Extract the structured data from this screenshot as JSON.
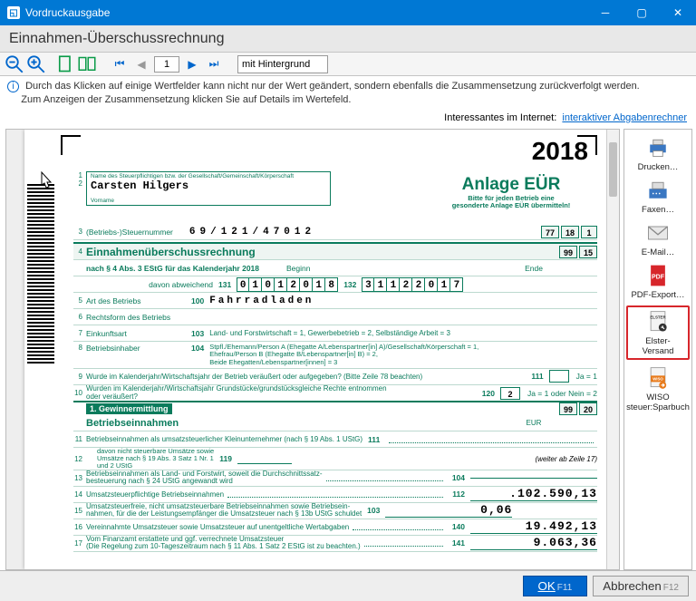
{
  "window": {
    "title": "Vordruckausgabe"
  },
  "header": {
    "title": "Einnahmen-Überschussrechnung"
  },
  "toolbar": {
    "page_current": "1",
    "bg_option": "mit Hintergrund"
  },
  "hint": {
    "line1": "Durch das Klicken auf einige Wertfelder kann nicht nur der Wert geändert, sondern ebenfalls die Zusammensetzung zurückverfolgt werden.",
    "line2": "Zum Anzeigen der Zusammensetzung klicken Sie auf Details im Wertefeld."
  },
  "interest_label": "Interessantes im Internet:",
  "interest_link": "interaktiver Abgabenrechner",
  "form": {
    "year": "2018",
    "name_label": "Name des Steuerpflichtigen bzw. der Gesellschaft/Gemeinschaft/Körperschaft",
    "name_value": "Carsten Hilgers",
    "vorname_label": "Vorname",
    "anlage_title": "Anlage EÜR",
    "anlage_sub": "Bitte für jeden Betrieb eine\ngesonderte Anlage EÜR übermitteln!",
    "steuernummer_label": "(Betriebs-)Steuernummer",
    "steuernummer_value": "69/121/47012",
    "top_cells": [
      "77",
      "18",
      "1"
    ],
    "header2": "Einnahmenüberschussrechnung",
    "header2_cells": [
      "99",
      "15"
    ],
    "subline": "nach § 4 Abs. 3 EStG für das Kalenderjahr 2018",
    "beginn_label": "Beginn",
    "ende_label": "Ende",
    "abweichend": "davon abweichend",
    "code_131": "131",
    "code_132": "132",
    "beginn_date": [
      "0",
      "1",
      "0",
      "1",
      "2",
      "0",
      "1",
      "8"
    ],
    "ende_date": [
      "3",
      "1",
      "1",
      "2",
      "2",
      "0",
      "1",
      "7"
    ],
    "r5_label": "Art des Betriebs",
    "r5_code": "100",
    "r5_value": "Fahrradladen",
    "r6_label": "Rechtsform des Betriebs",
    "r7_label": "Einkunftsart",
    "r7_code": "103",
    "r7_text": "Land- und Forstwirtschaft = 1, Gewerbebetrieb = 2, Selbständige Arbeit = 3",
    "r8_label": "Betriebsinhaber",
    "r8_code": "104",
    "r8_text": "Stpfl./Ehemann/Person A (Ehegatte A/Lebenspartner[in] A)/Gesellschaft/Körperschaft = 1,\nEhefrau/Person B (Ehegatte B/Lebenspartner[in] B) = 2,\nBeide Ehegatten/Lebenspartner[innen] = 3",
    "r9_label": "Wurde im Kalenderjahr/Wirtschaftsjahr der Betrieb veräußert oder aufgegeben? (Bitte Zeile 78 beachten)",
    "r9_code": "111",
    "r9_legend": "Ja = 1",
    "r10_label": "Wurden im Kalenderjahr/Wirtschaftsjahr Grundstücke/grundstücksgleiche Rechte entnommen\noder veräußert?",
    "r10_code": "120",
    "r10_value": "2",
    "r10_legend": "Ja = 1 oder Nein = 2",
    "sect1_title": "1. Gewinnermittlung",
    "sect1_cells": [
      "99",
      "20"
    ],
    "betr_label": "Betriebseinnahmen",
    "eur_label": "EUR",
    "r11_label": "Betriebseinnahmen als umsatzsteuerlicher Kleinunternehmer (nach § 19 Abs. 1 UStG)",
    "r11_code": "111",
    "r12_label": "davon nicht steuerbare Umsätze sowie\nUmsätze nach § 19 Abs. 3 Satz 1 Nr. 1\nund 2 UStG",
    "r12_code": "119",
    "r12_note": "(weiter ab Zeile 17)",
    "r13_label": "Betriebseinnahmen als Land- und Forstwirt, soweit die Durchschnittssatz-\nbesteuerung nach § 24 UStG angewandt wird",
    "r13_code": "104",
    "r14_label": "Umsatzsteuerpflichtige Betriebseinnahmen",
    "r14_code": "112",
    "r14_value": ".102.590,13",
    "r15_label": "Umsatzsteuerfreie, nicht umsatzsteuerbare Betriebseinnahmen sowie Betriebsein-\nnahmen, für die der Leistungsempfänger die Umsatzsteuer nach § 13b UStG schuldet",
    "r15_code": "103",
    "r15_value": "0,06",
    "r16_label": "Vereinnahmte Umsatzsteuer sowie Umsatzsteuer auf unentgeltliche Wertabgaben",
    "r16_code": "140",
    "r16_value": "19.492,13",
    "r17_label": "Vom Finanzamt erstattete und ggf. verrechnete Umsatzsteuer\n(Die Regelung zum 10-Tageszeitraum nach § 11 Abs. 1 Satz 2 EStG ist zu beachten.)",
    "r17_code": "141",
    "r17_value": "9.063,36"
  },
  "sidebar": {
    "drucken": "Drucken…",
    "faxen": "Faxen…",
    "email": "E-Mail…",
    "pdf": "PDF-Export…",
    "elster": "Elster-Versand",
    "wiso": "WISO\nsteuer:Sparbuch"
  },
  "footer": {
    "ok": "OK",
    "ok_key": "F11",
    "cancel": "Abbrechen",
    "cancel_key": "F12"
  }
}
